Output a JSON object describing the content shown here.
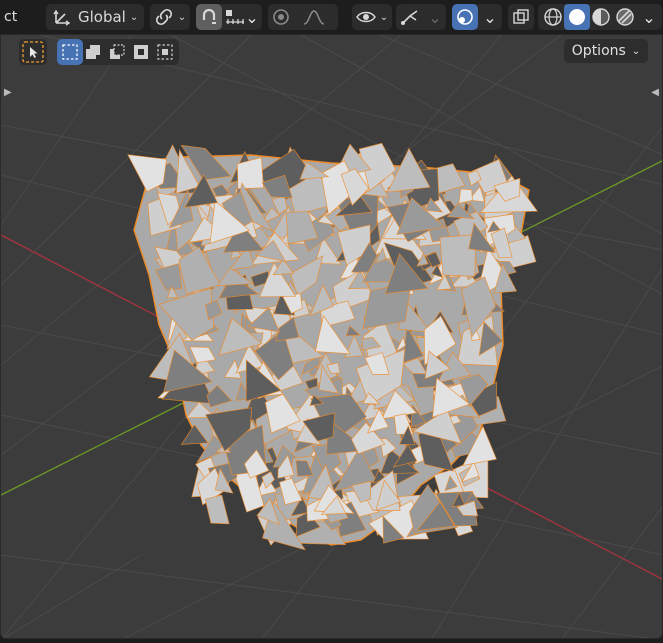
{
  "header": {
    "mode_label": "ct",
    "transform_orientation": "Global",
    "options_label": "Options"
  },
  "icons": {
    "orientation": "transform-orientation-icon",
    "pivot": "pivot-link-icon",
    "snap": "snap-magnet-icon",
    "snap_target": "snap-increment-icon",
    "proportional": "proportional-edit-icon",
    "falloff": "falloff-curve-icon",
    "visibility": "eye-icon",
    "gizmo": "gizmo-icon",
    "overlay": "overlay-icon",
    "xray": "xray-icon",
    "shading_wire": "wireframe-shading-icon",
    "shading_solid": "solid-shading-icon",
    "shading_material": "material-shading-icon",
    "shading_render": "rendered-shading-icon",
    "select_tool": "select-cursor-icon",
    "mode_new": "select-mode-new-icon",
    "mode_extend": "select-mode-extend-icon",
    "mode_subtract": "select-mode-subtract-icon",
    "mode_difference": "select-mode-difference-icon",
    "mode_intersect": "select-mode-intersect-icon"
  },
  "colors": {
    "accent": "#4772b3",
    "selection_outline": "#f08a24",
    "x_axis": "#a8343f",
    "y_axis": "#6c9a26",
    "viewport_bg": "#3c3c3c"
  }
}
